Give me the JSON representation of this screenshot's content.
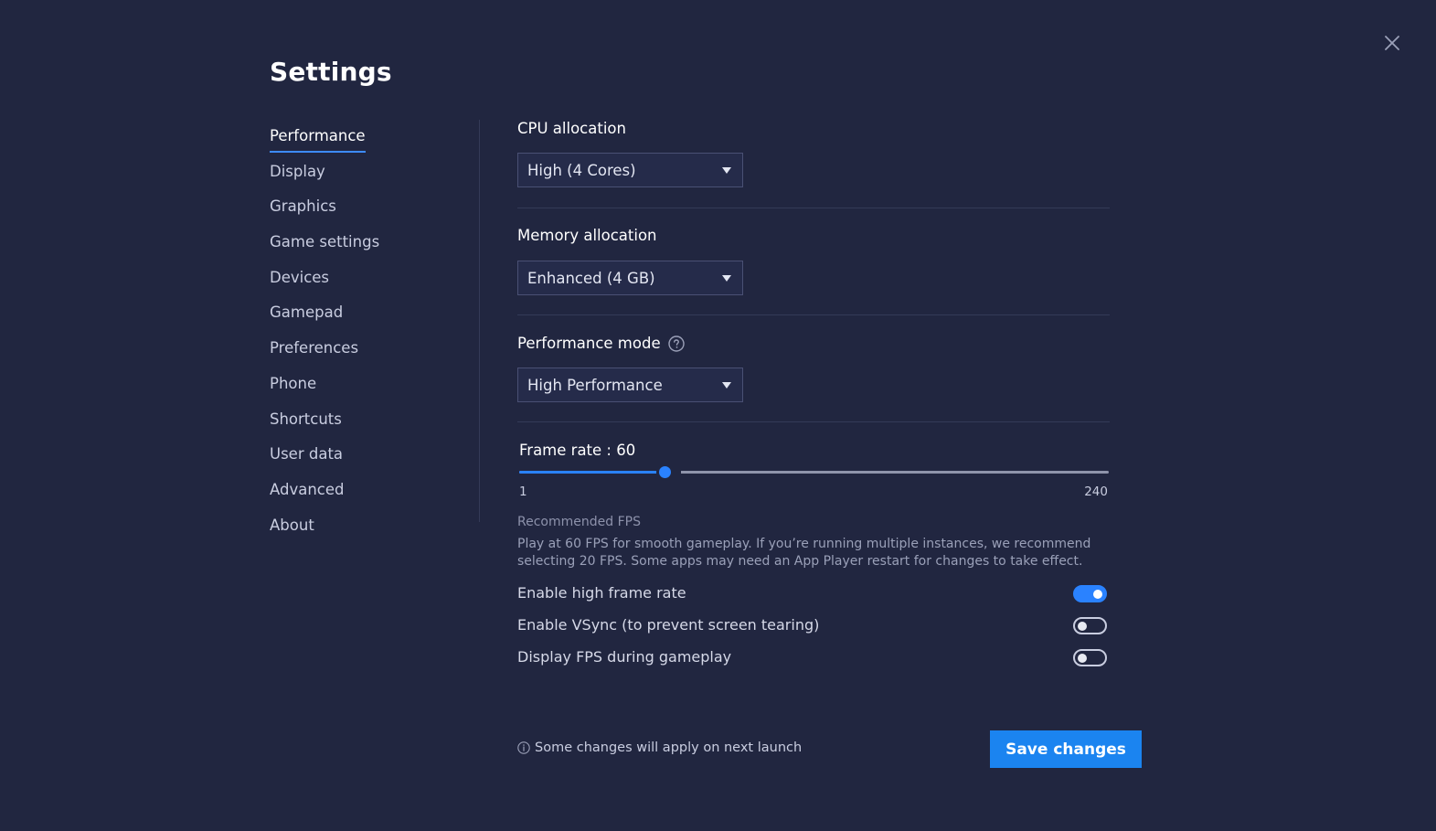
{
  "window": {
    "title": "Settings",
    "close_icon": "close-icon"
  },
  "sidebar": {
    "items": [
      {
        "label": "Performance",
        "active": true
      },
      {
        "label": "Display",
        "active": false
      },
      {
        "label": "Graphics",
        "active": false
      },
      {
        "label": "Game settings",
        "active": false
      },
      {
        "label": "Devices",
        "active": false
      },
      {
        "label": "Gamepad",
        "active": false
      },
      {
        "label": "Preferences",
        "active": false
      },
      {
        "label": "Phone",
        "active": false
      },
      {
        "label": "Shortcuts",
        "active": false
      },
      {
        "label": "User data",
        "active": false
      },
      {
        "label": "Advanced",
        "active": false
      },
      {
        "label": "About",
        "active": false
      }
    ]
  },
  "performance": {
    "cpu": {
      "label": "CPU allocation",
      "value": "High (4 Cores)"
    },
    "memory": {
      "label": "Memory allocation",
      "value": "Enhanced (4 GB)"
    },
    "mode": {
      "label": "Performance mode",
      "value": "High Performance",
      "help_icon": "question-circle-icon"
    },
    "frame_rate": {
      "label": "Frame rate : 60",
      "value": 60,
      "min": 1,
      "max": 240,
      "min_label": "1",
      "max_label": "240"
    },
    "recommended": {
      "title": "Recommended FPS",
      "text": "Play at 60 FPS for smooth gameplay. If you’re running multiple instances, we recommend selecting 20 FPS. Some apps may need an App Player restart for changes to take effect."
    },
    "toggles": [
      {
        "label": "Enable high frame rate",
        "on": true
      },
      {
        "label": "Enable VSync (to prevent screen tearing)",
        "on": false
      },
      {
        "label": "Display FPS during gameplay",
        "on": false
      }
    ]
  },
  "footer": {
    "note": "Some changes will apply on next launch",
    "note_icon": "info-circle-icon",
    "save_label": "Save changes"
  },
  "colors": {
    "background": "#212640",
    "accent": "#1b84f0",
    "divider": "#343a57"
  }
}
